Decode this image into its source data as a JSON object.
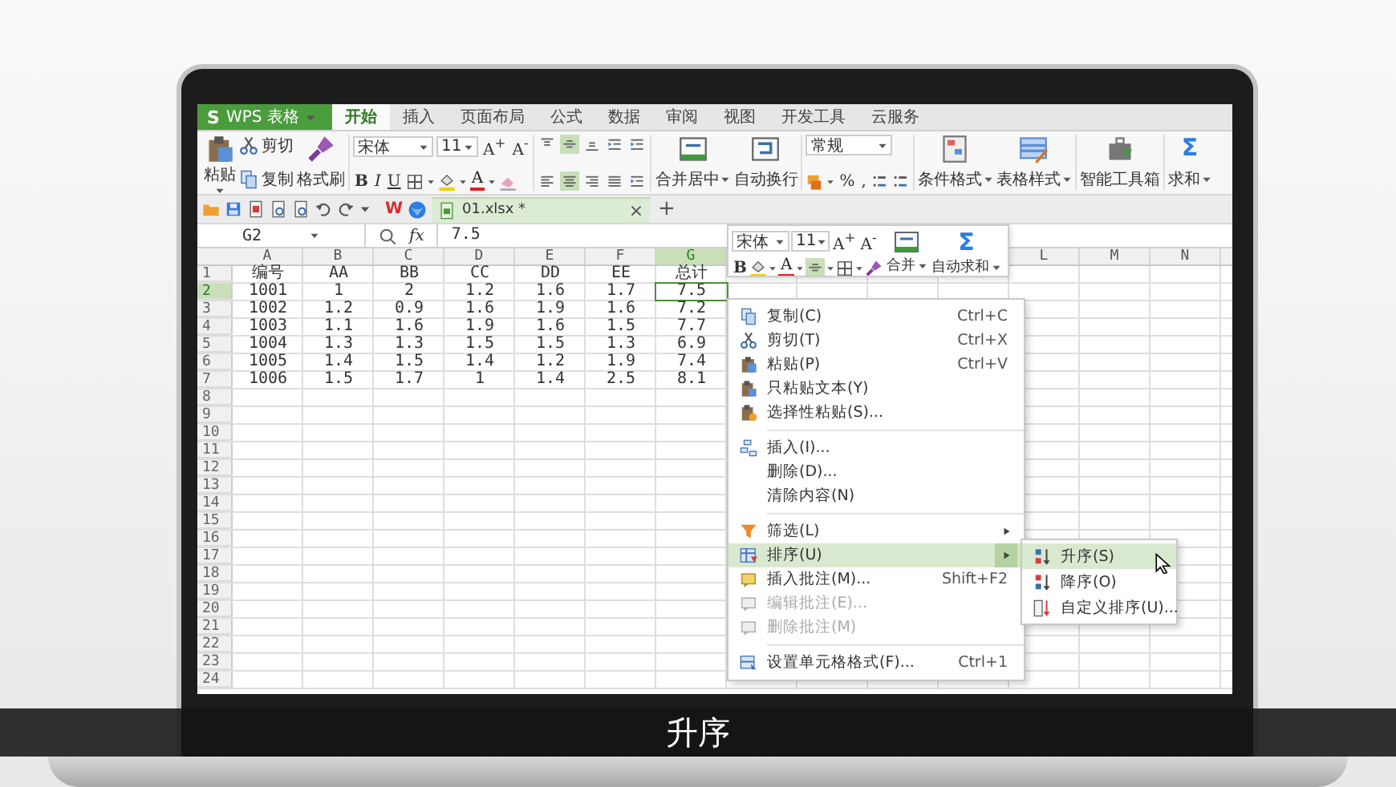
{
  "caption": "升序",
  "app_button": {
    "logo": "S",
    "label": "WPS 表格"
  },
  "tabs": [
    {
      "label": "开始",
      "selected": true
    },
    {
      "label": "插入",
      "selected": false
    },
    {
      "label": "页面布局",
      "selected": false
    },
    {
      "label": "公式",
      "selected": false
    },
    {
      "label": "数据",
      "selected": false
    },
    {
      "label": "审阅",
      "selected": false
    },
    {
      "label": "视图",
      "selected": false
    },
    {
      "label": "开发工具",
      "selected": false
    },
    {
      "label": "云服务",
      "selected": false
    }
  ],
  "ribbon": {
    "paste": "粘贴",
    "cut": "剪切",
    "copy": "复制",
    "format_painter": "格式刷",
    "font": "宋体",
    "size": "11",
    "grow": "A$^{+}$",
    "shrink": "A$^{-}$",
    "bold": "B",
    "italic": "I",
    "underline": "U",
    "font_color": "A",
    "align_rows": [
      [
        {
          "selected": false
        },
        {
          "selected": true
        },
        {
          "selected": false
        },
        {
          "selected": false
        },
        {
          "selected": false
        }
      ],
      [
        {
          "selected": false
        },
        {
          "selected": true
        },
        {
          "selected": false
        },
        {
          "selected": false
        },
        {
          "selected": false
        }
      ]
    ],
    "merge": "合并居中",
    "wrap": "自动换行",
    "number_format": "常规",
    "percent": "%",
    "comma": ",",
    "conditional_format": "条件格式",
    "table_style": "表格样式",
    "toolbox": "智能工具箱",
    "sum_symbol": "Σ",
    "sum": "求和"
  },
  "quick_bar": {
    "wps_logo": "W"
  },
  "document_tab": {
    "title": "01.xlsx *",
    "close": "×",
    "new_tab": "+"
  },
  "formula_bar": {
    "name_box": "G2",
    "fx": "fx",
    "formula": "7.5"
  },
  "sheet": {
    "column_headers": [
      {
        "label": "A",
        "selected": false
      },
      {
        "label": "B",
        "selected": false
      },
      {
        "label": "C",
        "selected": false
      },
      {
        "label": "D",
        "selected": false
      },
      {
        "label": "E",
        "selected": false
      },
      {
        "label": "F",
        "selected": false
      },
      {
        "label": "G",
        "selected": true
      }
    ],
    "right_column_headers": [
      {
        "label": "L",
        "selected": false
      },
      {
        "label": "M",
        "selected": false
      },
      {
        "label": "N",
        "selected": false
      }
    ],
    "rows": [
      {
        "number": "1",
        "selected": false,
        "cells": [
          {
            "text": "编号",
            "selected": false
          },
          {
            "text": "AA",
            "selected": false
          },
          {
            "text": "BB",
            "selected": false
          },
          {
            "text": "CC",
            "selected": false
          },
          {
            "text": "DD",
            "selected": false
          },
          {
            "text": "EE",
            "selected": false
          },
          {
            "text": "总计",
            "selected": false
          }
        ]
      },
      {
        "number": "2",
        "selected": true,
        "cells": [
          {
            "text": "1001",
            "selected": false
          },
          {
            "text": "1",
            "selected": false
          },
          {
            "text": "2",
            "selected": false
          },
          {
            "text": "1.2",
            "selected": false
          },
          {
            "text": "1.6",
            "selected": false
          },
          {
            "text": "1.7",
            "selected": false
          },
          {
            "text": "7.5",
            "selected": true
          }
        ]
      },
      {
        "number": "3",
        "selected": false,
        "cells": [
          {
            "text": "1002",
            "selected": false
          },
          {
            "text": "1.2",
            "selected": false
          },
          {
            "text": "0.9",
            "selected": false
          },
          {
            "text": "1.6",
            "selected": false
          },
          {
            "text": "1.9",
            "selected": false
          },
          {
            "text": "1.6",
            "selected": false
          },
          {
            "text": "7.2",
            "selected": false
          }
        ]
      },
      {
        "number": "4",
        "selected": false,
        "cells": [
          {
            "text": "1003",
            "selected": false
          },
          {
            "text": "1.1",
            "selected": false
          },
          {
            "text": "1.6",
            "selected": false
          },
          {
            "text": "1.9",
            "selected": false
          },
          {
            "text": "1.6",
            "selected": false
          },
          {
            "text": "1.5",
            "selected": false
          },
          {
            "text": "7.7",
            "selected": false
          }
        ]
      },
      {
        "number": "5",
        "selected": false,
        "cells": [
          {
            "text": "1004",
            "selected": false
          },
          {
            "text": "1.3",
            "selected": false
          },
          {
            "text": "1.3",
            "selected": false
          },
          {
            "text": "1.5",
            "selected": false
          },
          {
            "text": "1.5",
            "selected": false
          },
          {
            "text": "1.3",
            "selected": false
          },
          {
            "text": "6.9",
            "selected": false
          }
        ]
      },
      {
        "number": "6",
        "selected": false,
        "cells": [
          {
            "text": "1005",
            "selected": false
          },
          {
            "text": "1.4",
            "selected": false
          },
          {
            "text": "1.5",
            "selected": false
          },
          {
            "text": "1.4",
            "selected": false
          },
          {
            "text": "1.2",
            "selected": false
          },
          {
            "text": "1.9",
            "selected": false
          },
          {
            "text": "7.4",
            "selected": false
          }
        ]
      },
      {
        "number": "7",
        "selected": false,
        "cells": [
          {
            "text": "1006",
            "selected": false
          },
          {
            "text": "1.5",
            "selected": false
          },
          {
            "text": "1.7",
            "selected": false
          },
          {
            "text": "1",
            "selected": false
          },
          {
            "text": "1.4",
            "selected": false
          },
          {
            "text": "2.5",
            "selected": false
          },
          {
            "text": "8.1",
            "selected": false
          }
        ]
      },
      {
        "number": "8",
        "selected": false
      },
      {
        "number": "9",
        "selected": false
      },
      {
        "number": "10",
        "selected": false
      },
      {
        "number": "11",
        "selected": false
      },
      {
        "number": "12",
        "selected": false
      },
      {
        "number": "13",
        "selected": false
      },
      {
        "number": "14",
        "selected": false
      },
      {
        "number": "15",
        "selected": false
      },
      {
        "number": "16",
        "selected": false
      },
      {
        "number": "17",
        "selected": false
      },
      {
        "number": "18",
        "selected": false
      },
      {
        "number": "19",
        "selected": false
      },
      {
        "number": "20",
        "selected": false
      },
      {
        "number": "21",
        "selected": false
      },
      {
        "number": "22",
        "selected": false
      },
      {
        "number": "23",
        "selected": false
      },
      {
        "number": "24",
        "selected": false
      }
    ]
  },
  "mini_toolbar": {
    "font": "宋体",
    "size": "11",
    "grow": "A$^{+}$",
    "shrink": "A$^{-}$",
    "merge": "合并",
    "sum_symbol": "Σ",
    "sum": "自动求和",
    "bold": "B",
    "font_color": "A",
    "align_selected": true
  },
  "context_menu": {
    "groups": [
      [
        {
          "label": "复制(C)",
          "shortcut": "Ctrl+C",
          "disabled": false,
          "selected": false,
          "submenu": false
        },
        {
          "label": "剪切(T)",
          "shortcut": "Ctrl+X",
          "disabled": false,
          "selected": false,
          "submenu": false
        },
        {
          "label": "粘贴(P)",
          "shortcut": "Ctrl+V",
          "disabled": false,
          "selected": false,
          "submenu": false
        },
        {
          "label": "只粘贴文本(Y)",
          "disabled": false,
          "selected": false,
          "submenu": false
        },
        {
          "label": "选择性粘贴(S)...",
          "disabled": false,
          "selected": false,
          "submenu": false
        }
      ],
      [
        {
          "label": "插入(I)...",
          "disabled": false,
          "selected": false,
          "submenu": false
        },
        {
          "label": "删除(D)...",
          "disabled": false,
          "selected": false,
          "submenu": false
        },
        {
          "label": "清除内容(N)",
          "disabled": false,
          "selected": false,
          "submenu": false
        }
      ],
      [
        {
          "label": "筛选(L)",
          "disabled": false,
          "selected": false,
          "submenu": true
        },
        {
          "label": "排序(U)",
          "disabled": false,
          "selected": true,
          "submenu": true
        },
        {
          "label": "插入批注(M)...",
          "shortcut": "Shift+F2",
          "disabled": false,
          "selected": false,
          "submenu": false
        },
        {
          "label": "编辑批注(E)...",
          "disabled": true,
          "selected": false,
          "submenu": false
        },
        {
          "label": "删除批注(M)",
          "disabled": true,
          "selected": false,
          "submenu": false
        }
      ],
      [
        {
          "label": "设置单元格格式(F)...",
          "shortcut": "Ctrl+1",
          "disabled": false,
          "selected": false,
          "submenu": false
        }
      ]
    ]
  },
  "submenu": [
    {
      "label": "升序(S)",
      "selected": true
    },
    {
      "label": "降序(O)",
      "selected": false
    },
    {
      "label": "自定义排序(U)...",
      "selected": false
    }
  ]
}
